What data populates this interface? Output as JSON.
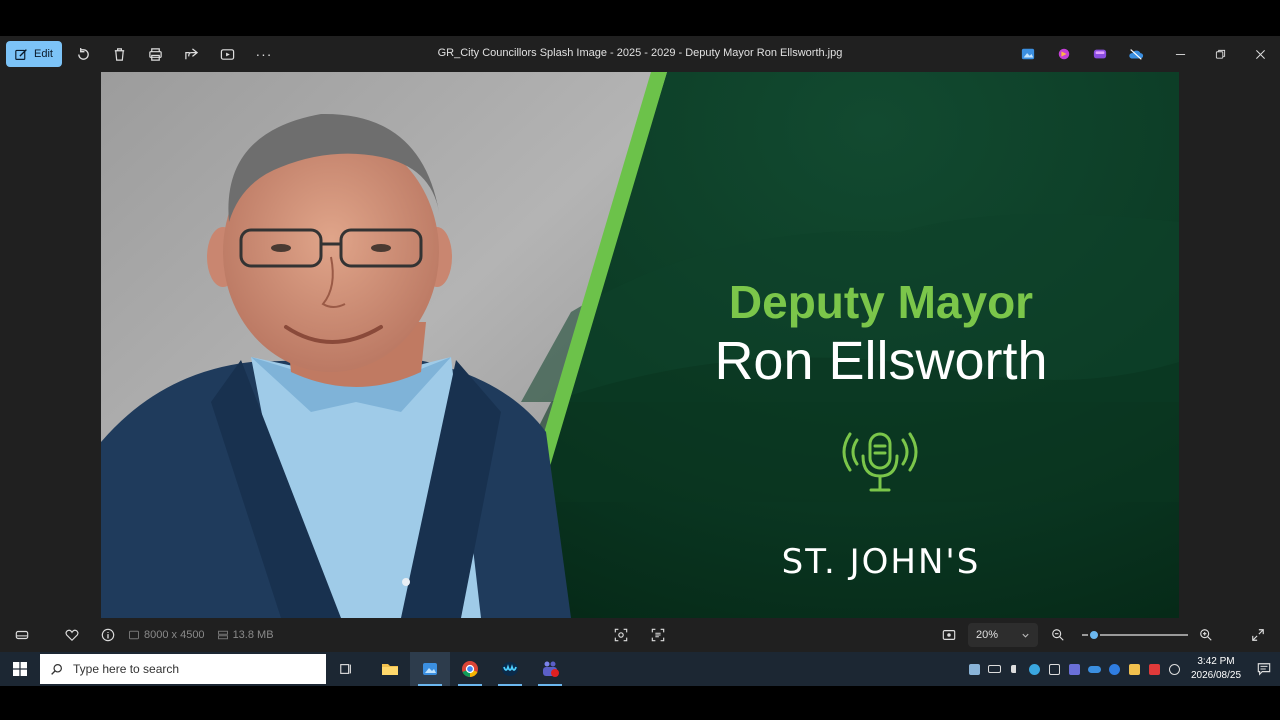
{
  "window": {
    "title": "GR_City Councillors Splash Image - 2025 - 2029 - Deputy Mayor Ron Ellsworth.jpg",
    "edit_label": "Edit",
    "more_label": "···"
  },
  "image": {
    "role": "Deputy Mayor",
    "name": "Ron Ellsworth",
    "brand": "ST. JOHN'S",
    "colors": {
      "green_dark": "#0b3a24",
      "accent": "#7bc64a"
    }
  },
  "infobar": {
    "dimensions": "8000 x 4500",
    "file_size": "13.8 MB",
    "zoom": "20%",
    "zoom_level": 0.06
  },
  "taskbar": {
    "search_placeholder": "Type here to search",
    "time": "3:42 PM",
    "date": "2026/08/25"
  }
}
